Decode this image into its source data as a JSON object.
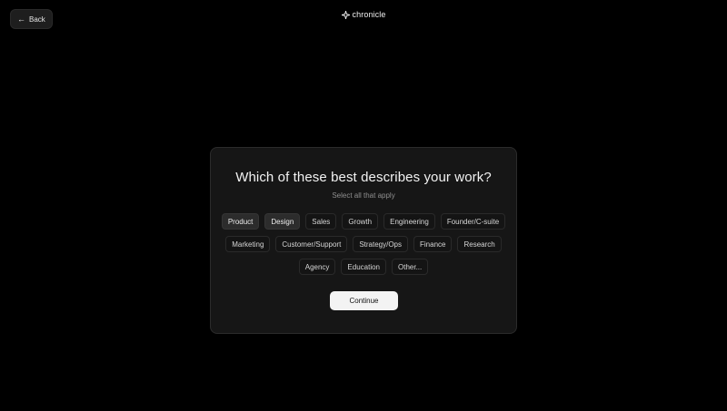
{
  "header": {
    "back_label": "Back",
    "brand_name": "chronicle"
  },
  "onboarding": {
    "question": "Which of these best describes your work?",
    "hint": "Select all that apply",
    "options_row1": [
      {
        "label": "Product",
        "selected": true
      },
      {
        "label": "Design",
        "selected": true
      },
      {
        "label": "Sales",
        "selected": false
      },
      {
        "label": "Growth",
        "selected": false
      },
      {
        "label": "Engineering",
        "selected": false
      },
      {
        "label": "Founder/C-suite",
        "selected": false
      }
    ],
    "options_row2": [
      {
        "label": "Marketing",
        "selected": false
      },
      {
        "label": "Customer/Support",
        "selected": false
      },
      {
        "label": "Strategy/Ops",
        "selected": false
      },
      {
        "label": "Finance",
        "selected": false
      },
      {
        "label": "Research",
        "selected": false
      }
    ],
    "options_row3": [
      {
        "label": "Agency",
        "selected": false
      },
      {
        "label": "Education",
        "selected": false
      },
      {
        "label": "Other...",
        "selected": false
      }
    ],
    "continue_label": "Continue"
  },
  "colors": {
    "background": "#000000",
    "card": "#161616",
    "chip_selected": "#2c2c2c",
    "primary_button": "#f3f3f3"
  },
  "icons": {
    "back": "arrow-left-icon",
    "brand": "sparkle-logo-icon"
  }
}
